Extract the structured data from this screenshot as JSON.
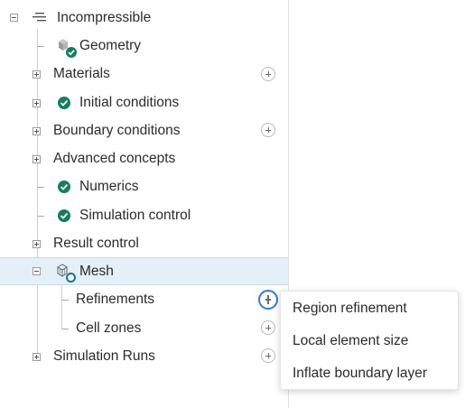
{
  "tree": {
    "root_label": "Incompressible",
    "items": {
      "geometry": "Geometry",
      "materials": "Materials",
      "initial_conditions": "Initial conditions",
      "boundary_conditions": "Boundary conditions",
      "advanced_concepts": "Advanced concepts",
      "numerics": "Numerics",
      "simulation_control": "Simulation control",
      "result_control": "Result control",
      "mesh": "Mesh",
      "refinements": "Refinements",
      "cell_zones": "Cell zones",
      "simulation_runs": "Simulation Runs"
    }
  },
  "context_menu": {
    "items": [
      "Region refinement",
      "Local element size",
      "Inflate boundary layer"
    ]
  },
  "colors": {
    "check_green": "#12805c",
    "selected_bg": "#e3f0f8",
    "accent_blue": "#2c7be5"
  },
  "icons": {
    "root": "list-icon",
    "geometry": "geometry-cube-icon",
    "mesh": "mesh-cube-icon",
    "status_ok": "check-circle-icon",
    "status_mesh": "pending-circle-icon"
  }
}
